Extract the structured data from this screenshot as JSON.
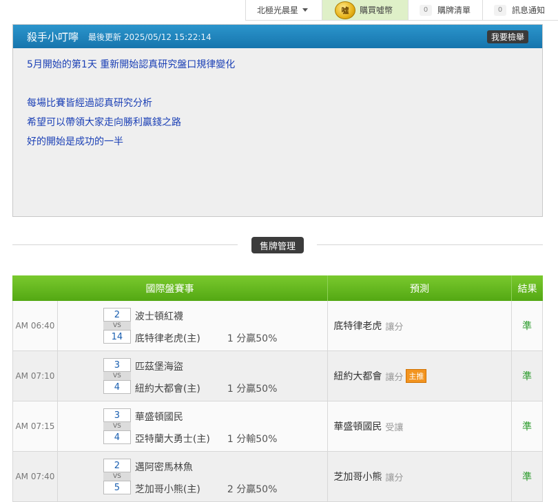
{
  "topbar": {
    "user_name": "北極光晨星",
    "buy_coin_label": "購買噓幣",
    "coin_glyph": "噓",
    "list_count": "0",
    "list_label": "購牌清單",
    "msg_count": "0",
    "msg_label": "訊息通知"
  },
  "article": {
    "author": "殺手小叮嚀",
    "updated": "最後更新 2025/05/12 15:22:14",
    "ticket_button": "我要檢舉",
    "lines": [
      "5月開始的第1天 重新開始認真研究盤口規律變化",
      "",
      "每場比賽皆經過認真研究分析",
      "希望可以帶領大家走向勝利贏錢之路",
      "好的開始是成功的一半"
    ]
  },
  "divider": {
    "label": "售牌管理"
  },
  "table": {
    "headers": {
      "event": "國際盤賽事",
      "prediction": "預測",
      "result": "結果"
    },
    "rows": [
      {
        "time": "AM 06:40",
        "score_away": "2",
        "vs": "VS",
        "score_home": "14",
        "away": "波士頓紅襪",
        "home": "底特律老虎(主)",
        "odds": "1 分贏50%",
        "pred_team": "底特律老虎",
        "pred_type": "讓分",
        "badge": "",
        "result": "準"
      },
      {
        "time": "AM 07:10",
        "score_away": "3",
        "vs": "VS",
        "score_home": "4",
        "away": "匹茲堡海盜",
        "home": "紐約大都會(主)",
        "odds": "1 分贏50%",
        "pred_team": "紐約大都會",
        "pred_type": "讓分",
        "badge": "主推",
        "result": "準"
      },
      {
        "time": "AM 07:15",
        "score_away": "3",
        "vs": "VS",
        "score_home": "4",
        "away": "華盛頓國民",
        "home": "亞特蘭大勇士(主)",
        "odds": "1 分輸50%",
        "pred_team": "華盛頓國民",
        "pred_type": "受讓",
        "badge": "",
        "result": "準"
      },
      {
        "time": "AM 07:40",
        "score_away": "2",
        "vs": "VS",
        "score_home": "5",
        "away": "邁阿密馬林魚",
        "home": "芝加哥小熊(主)",
        "odds": "2 分贏50%",
        "pred_team": "芝加哥小熊",
        "pred_type": "讓分",
        "badge": "",
        "result": "準"
      }
    ]
  },
  "colors": {
    "header_blue": "#1e86c0",
    "table_green": "#64b81f",
    "link_blue": "#1a3fb5",
    "result_green": "#2a9a2a",
    "badge_orange": "#f29420"
  }
}
